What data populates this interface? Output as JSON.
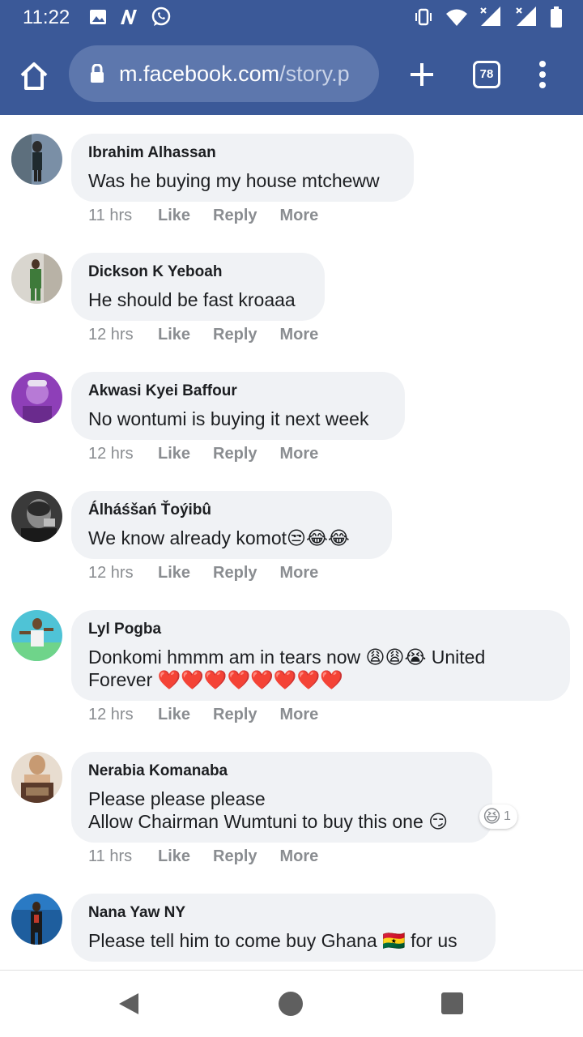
{
  "status_bar": {
    "time": "11:22",
    "left_icons": [
      "image-icon",
      "nfc-icon",
      "whatsapp-icon"
    ],
    "right_icons": [
      "vibrate-icon",
      "wifi-icon",
      "signal-icon",
      "signal-icon",
      "battery-icon"
    ]
  },
  "browser": {
    "url_host": "m.facebook.com",
    "url_path": "/story.p",
    "tab_count": "78"
  },
  "comments": [
    {
      "author": "Ibrahim Alhassan",
      "text": "Was he buying my house mtcheww",
      "time": "11 hrs"
    },
    {
      "author": "Dickson K Yeboah",
      "text": "He should be fast kroaaa",
      "time": "12 hrs"
    },
    {
      "author": "Akwasi Kyei Baffour",
      "text": "No wontumi is buying it next week",
      "time": "12 hrs"
    },
    {
      "author": "Álháśšań Ťoýibû",
      "text": "We know already komot😒😂😂",
      "time": "12 hrs"
    },
    {
      "author": "Lyl Pogba",
      "text": "Donkomi hmmm am in tears now 😩😩😭 United\nForever ❤️❤️❤️❤️❤️❤️❤️❤️",
      "time": "12 hrs"
    },
    {
      "author": "Nerabia Komanaba",
      "text": "Please please please\nAllow Chairman Wumtuni to buy this one 😏",
      "time": "11 hrs",
      "reaction_emoji": "😆",
      "reaction_count": "1"
    },
    {
      "author": "Nana Yaw NY",
      "text": "Please tell him to come buy Ghana 🇬🇭 for us",
      "time": ""
    }
  ],
  "actions": {
    "like": "Like",
    "reply": "Reply",
    "more": "More"
  },
  "colors": {
    "facebook_blue": "#3b5998",
    "bubble": "#f0f2f5",
    "meta_text": "#8a8d91"
  }
}
